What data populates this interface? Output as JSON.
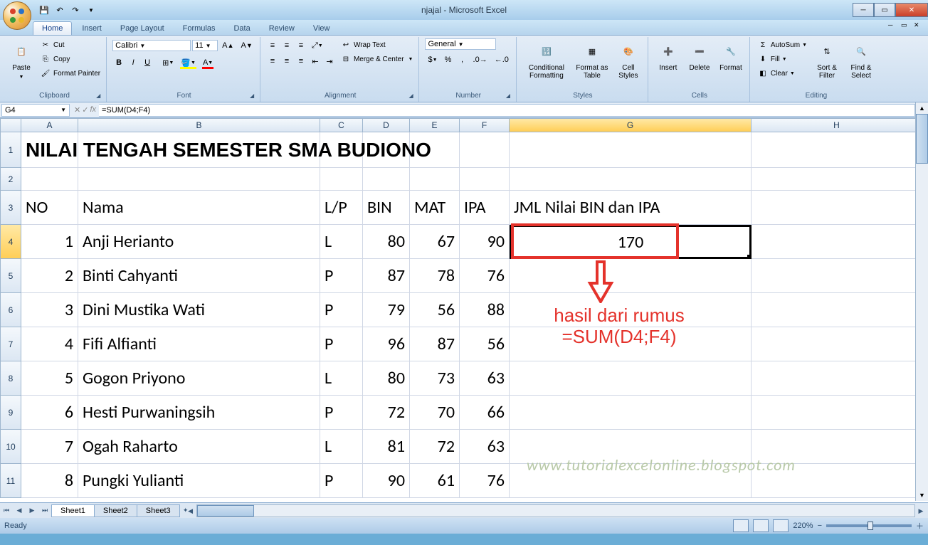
{
  "window": {
    "title": "njajal - Microsoft Excel"
  },
  "qat": {
    "items": [
      "save",
      "undo",
      "redo"
    ]
  },
  "tabs": [
    "Home",
    "Insert",
    "Page Layout",
    "Formulas",
    "Data",
    "Review",
    "View"
  ],
  "activeTab": "Home",
  "ribbon": {
    "clipboard": {
      "label": "Clipboard",
      "paste": "Paste",
      "cut": "Cut",
      "copy": "Copy",
      "painter": "Format Painter"
    },
    "font": {
      "label": "Font",
      "name": "Calibri",
      "size": "11",
      "bold": "B",
      "italic": "I",
      "underline": "U"
    },
    "alignment": {
      "label": "Alignment",
      "wrap": "Wrap Text",
      "merge": "Merge & Center"
    },
    "number": {
      "label": "Number",
      "format": "General"
    },
    "styles": {
      "label": "Styles",
      "cond": "Conditional Formatting",
      "table": "Format as Table",
      "cell": "Cell Styles"
    },
    "cells": {
      "label": "Cells",
      "insert": "Insert",
      "delete": "Delete",
      "format": "Format"
    },
    "editing": {
      "label": "Editing",
      "autosum": "AutoSum",
      "fill": "Fill",
      "clear": "Clear",
      "sort": "Sort & Filter",
      "find": "Find & Select"
    }
  },
  "namebox": "G4",
  "formula": "=SUM(D4;F4)",
  "columns": [
    "A",
    "B",
    "C",
    "D",
    "E",
    "F",
    "G",
    "H"
  ],
  "selectedCol": "G",
  "selectedRow": 4,
  "titleRow": "NILAI TENGAH SEMESTER SMA BUDIONO",
  "headerRow": {
    "A": "NO",
    "B": "Nama",
    "C": "L/P",
    "D": "BIN",
    "E": "MAT",
    "F": "IPA",
    "G": "JML Nilai BIN dan IPA"
  },
  "dataRows": [
    {
      "no": 1,
      "nama": "Anji Herianto",
      "lp": "L",
      "bin": 80,
      "mat": 67,
      "ipa": 90,
      "jml": 170
    },
    {
      "no": 2,
      "nama": "Binti Cahyanti",
      "lp": "P",
      "bin": 87,
      "mat": 78,
      "ipa": 76,
      "jml": ""
    },
    {
      "no": 3,
      "nama": "Dini Mustika Wati",
      "lp": "P",
      "bin": 79,
      "mat": 56,
      "ipa": 88,
      "jml": ""
    },
    {
      "no": 4,
      "nama": "Fifi Alfianti",
      "lp": "P",
      "bin": 96,
      "mat": 87,
      "ipa": 56,
      "jml": ""
    },
    {
      "no": 5,
      "nama": "Gogon Priyono",
      "lp": "L",
      "bin": 80,
      "mat": 73,
      "ipa": 63,
      "jml": ""
    },
    {
      "no": 6,
      "nama": "Hesti Purwaningsih",
      "lp": "P",
      "bin": 72,
      "mat": 70,
      "ipa": 66,
      "jml": ""
    },
    {
      "no": 7,
      "nama": "Ogah Raharto",
      "lp": "L",
      "bin": 81,
      "mat": 72,
      "ipa": 63,
      "jml": ""
    },
    {
      "no": 8,
      "nama": "Pungki Yulianti",
      "lp": "P",
      "bin": 90,
      "mat": 61,
      "ipa": 76,
      "jml": ""
    }
  ],
  "annotation": {
    "line1": "hasil dari rumus",
    "line2": "=SUM(D4;F4)"
  },
  "watermark": "www.tutorialexcelonline.blogspot.com",
  "sheets": [
    "Sheet1",
    "Sheet2",
    "Sheet3"
  ],
  "activeSheet": "Sheet1",
  "status": {
    "ready": "Ready",
    "zoom": "220%"
  }
}
